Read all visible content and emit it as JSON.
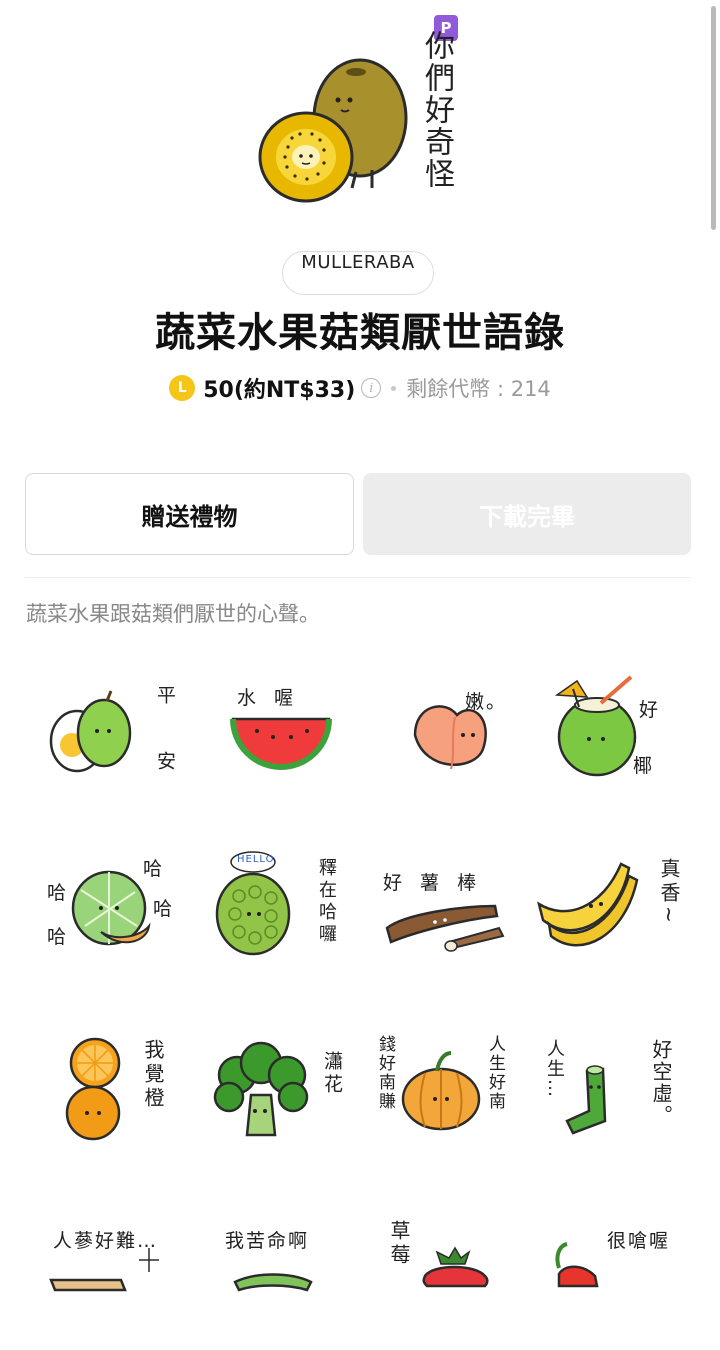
{
  "hero": {
    "badge": "P",
    "caption": "你們好奇怪"
  },
  "author": "MULLERABA",
  "title": "蔬菜水果菇類厭世語錄",
  "price": {
    "coin_symbol": "L",
    "amount_label": "50(約NT$33)",
    "info_symbol": "i",
    "balance_label": "剩餘代幣 : 214"
  },
  "buttons": {
    "gift": "贈送禮物",
    "download": "下載完畢"
  },
  "description": "蔬菜水果跟菇類們厭世的心聲。",
  "stickers": [
    {
      "name": "apple-egg-sticker",
      "text_a": "平",
      "text_b": "安"
    },
    {
      "name": "watermelon-sticker",
      "text_a": "水  喔"
    },
    {
      "name": "peach-sticker",
      "text_a": "嫩。"
    },
    {
      "name": "coconut-sticker",
      "text_a": "好",
      "text_b": "椰"
    },
    {
      "name": "melon-sticker",
      "text_a": "哈",
      "text_b": "哈",
      "text_c": "哈",
      "text_d": "哈"
    },
    {
      "name": "custard-apple-sticker",
      "text_a": "HELLO",
      "text_b": "釋在哈囉"
    },
    {
      "name": "yam-sticker",
      "text_a": "好 薯 棒"
    },
    {
      "name": "banana-sticker",
      "text_a": "真香~"
    },
    {
      "name": "orange-sticker",
      "text_a": "我覺橙"
    },
    {
      "name": "broccoli-sticker",
      "text_a": "瀟花"
    },
    {
      "name": "pumpkin-sticker",
      "text_a": "錢好南賺",
      "text_b": "人生好南"
    },
    {
      "name": "green-onion-sticker",
      "text_a": "人生…",
      "text_b": "好空虛。"
    },
    {
      "name": "ginseng-sticker",
      "text_a": "人蔘好難…"
    },
    {
      "name": "bitter-melon-sticker",
      "text_a": "我苦命啊"
    },
    {
      "name": "strawberry-sticker",
      "text_a": "草莓"
    },
    {
      "name": "chili-sticker",
      "text_a": "很嗆喔"
    }
  ],
  "colors": {
    "accent_purple": "#8f5bd8",
    "coin_yellow": "#f5c518",
    "disabled_button": "#ececec"
  }
}
